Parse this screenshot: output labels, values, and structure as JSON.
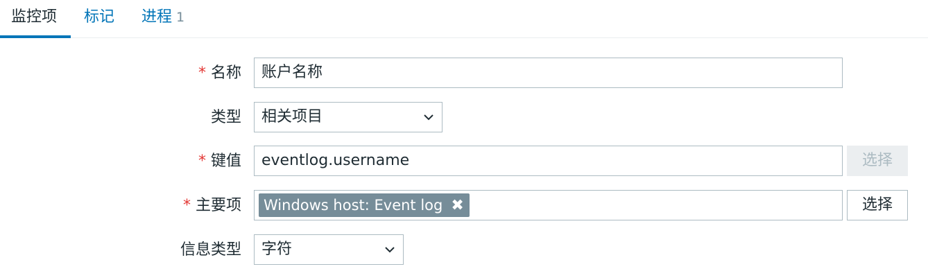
{
  "tabs": [
    {
      "label": "监控项",
      "active": true
    },
    {
      "label": "标记"
    },
    {
      "label": "进程",
      "count": "1"
    }
  ],
  "form": {
    "name": {
      "label": "名称",
      "required": "*",
      "value": "账户名称"
    },
    "type": {
      "label": "类型",
      "value": "相关项目"
    },
    "key": {
      "label": "键值",
      "required": "*",
      "value": "eventlog.username",
      "button": "选择"
    },
    "master_item": {
      "label": "主要项",
      "required": "*",
      "tag": "Windows host: Event log",
      "remove_icon": "✖",
      "button": "选择"
    },
    "value_type": {
      "label": "信息类型",
      "value": "字符"
    }
  },
  "colors": {
    "accent": "#0275b8",
    "required": "#e33734",
    "tag_bg": "#768d99"
  }
}
